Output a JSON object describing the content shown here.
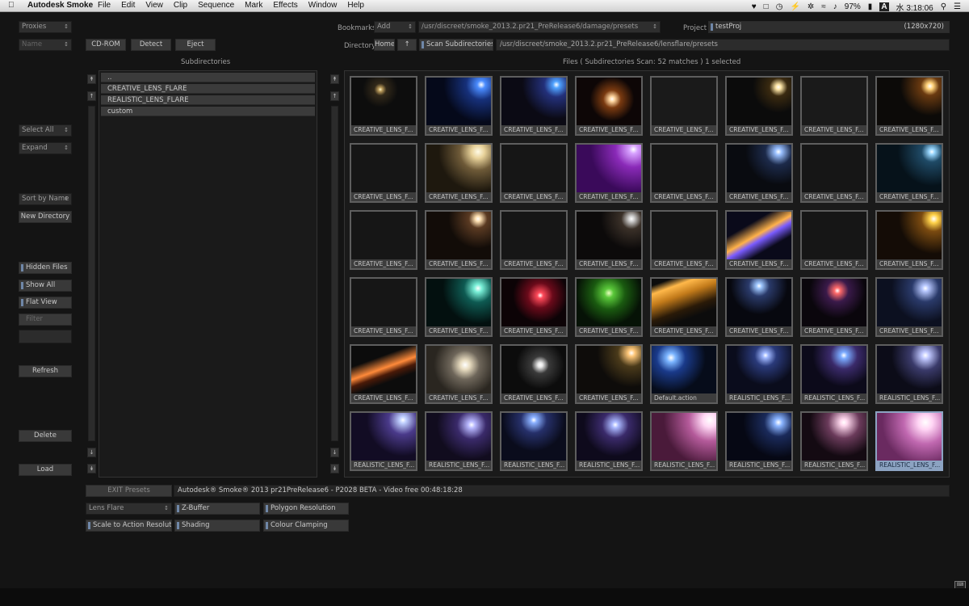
{
  "menubar": {
    "app_name": "Autodesk Smoke",
    "menus": [
      "File",
      "Edit",
      "View",
      "Clip",
      "Sequence",
      "Mark",
      "Effects",
      "Window",
      "Help"
    ],
    "battery": "97%",
    "input_mode": "A",
    "clock": "水 3:18:06"
  },
  "left": {
    "proxies": "Proxies",
    "name": "Name",
    "select_all": "Select All",
    "expand": "Expand",
    "sort_by_name": "Sort by Name",
    "new_directory": "New Directory",
    "hidden_files": "Hidden Files",
    "show_all": "Show All",
    "flat_view": "Flat View",
    "filter": "Filter",
    "filter_value": "",
    "refresh": "Refresh",
    "delete": "Delete",
    "load": "Load"
  },
  "devices": {
    "cdrom": "CD-ROM",
    "detect": "Detect",
    "eject": "Eject"
  },
  "top": {
    "bookmarks_label": "Bookmarks",
    "bookmarks_value": "Add",
    "bookmark_path": "/usr/discreet/smoke_2013.2.pr21_PreRelease6/damage/presets",
    "project_label": "Project",
    "project_value": "testProj",
    "project_res": "(1280x720)",
    "directory_label": "Directory",
    "home": "Home",
    "up_arrow": "↑",
    "scan_subdirs": "Scan Subdirectories",
    "directory_path": "/usr/discreet/smoke_2013.2.pr21_PreRelease6/lensflare/presets"
  },
  "subdirs": {
    "title": "Subdirectories",
    "items": [
      "..",
      "CREATIVE_LENS_FLARE",
      "REALISTIC_LENS_FLARE",
      "custom"
    ]
  },
  "files": {
    "title": "Files  ( Subdirectories Scan: 52 matches )  1 selected",
    "tiles": [
      {
        "label": "CREATIVE_LENS_F...",
        "bg": "radial-gradient(circle at 45% 25%, #fff6c8 0, #b99a5a 4%, rgba(120,90,40,0.3) 12%, #0d0d0d 35%)"
      },
      {
        "label": "CREATIVE_LENS_F...",
        "bg": "radial-gradient(circle at 85% 15%, #ffffff 0, #4a8cff 6%, #16307a 22%, #05091a 55%)"
      },
      {
        "label": "CREATIVE_LENS_F...",
        "bg": "radial-gradient(circle at 85% 15%, #ffffff 0, #4fa2ff 5%, #23307a 18%, #0b0a14 50%)"
      },
      {
        "label": "CREATIVE_LENS_F...",
        "bg": "radial-gradient(circle at 55% 45%, #ffffff 0, #ffd6a0 6%, #7a3a10 20%, #0d0606 50%)"
      },
      {
        "label": "CREATIVE_LENS_F...",
        "bg": "#1a1a1a"
      },
      {
        "label": "CREATIVE_LENS_F...",
        "bg": "radial-gradient(circle at 80% 20%, #ffffff 0, #ffe7a8 4%, #3a2a10 14%, #0b0b0b 40%)"
      },
      {
        "label": "CREATIVE_LENS_F...",
        "bg": "#1a1a1a"
      },
      {
        "label": "CREATIVE_LENS_F...",
        "bg": "radial-gradient(circle at 82% 18%, #ffffff 0, #ffd27a 5%, #6a3a10 14%, #0c0a08 45%)"
      },
      {
        "label": "CREATIVE_LENS_F...",
        "bg": "#161616"
      },
      {
        "label": "CREATIVE_LENS_F...",
        "bg": "radial-gradient(circle at 80% 15%, #fffbe6 0, #e8d29a 10%, #6e5a38 28%, #1e180e 60%)"
      },
      {
        "label": "CREATIVE_LENS_F...",
        "bg": "#161616"
      },
      {
        "label": "CREATIVE_LENS_F...",
        "bg": "radial-gradient(circle at 88% 10%, #ffffff 0, #d7a2ff 6%, #8a2ab8 25%, #3a0a5a 60%)"
      },
      {
        "label": "CREATIVE_LENS_F...",
        "bg": "#161616"
      },
      {
        "label": "CREATIVE_LENS_F...",
        "bg": "radial-gradient(circle at 80% 15%, #ffffff 0, #9ac0ff 5%, #1c2a4a 20%, #090b10 50%)"
      },
      {
        "label": "CREATIVE_LENS_F...",
        "bg": "#161616"
      },
      {
        "label": "CREATIVE_LENS_F...",
        "bg": "radial-gradient(circle at 85% 15%, #ffffff 0, #9ad8ff 4%, #1f4a66 15%, #06121a 50%)"
      },
      {
        "label": "CREATIVE_LENS_F...",
        "bg": "#161616"
      },
      {
        "label": "CREATIVE_LENS_F...",
        "bg": "radial-gradient(circle at 80% 15%, #ffffff 0, #ffe2b4 4%, #5a3a22 14%, #120c08 45%)"
      },
      {
        "label": "CREATIVE_LENS_F...",
        "bg": "#161616"
      },
      {
        "label": "CREATIVE_LENS_F...",
        "bg": "radial-gradient(circle at 85% 15%, #ffffff 0, #d0d0d0 4%, #3a3028 15%, #0c0a0a 45%)"
      },
      {
        "label": "CREATIVE_LENS_F...",
        "bg": "#161616"
      },
      {
        "label": "CREATIVE_LENS_F...",
        "bg": "linear-gradient(150deg, #0a0a1a 30%, #ffb24a 48%, #7a5cff 56%, #0a0a1a 72%)"
      },
      {
        "label": "CREATIVE_LENS_F...",
        "bg": "#161616"
      },
      {
        "label": "CREATIVE_LENS_F...",
        "bg": "radial-gradient(circle at 88% 15%, #ffffff 0, #ffd24a 6%, #7a4a10 18%, #140c06 50%)"
      },
      {
        "label": "CREATIVE_LENS_F...",
        "bg": "#161616"
      },
      {
        "label": "CREATIVE_LENS_F...",
        "bg": "radial-gradient(circle at 80% 20%, #ffffff 0, #7af0d8 6%, #0e5a52 22%, #03100f 55%)"
      },
      {
        "label": "CREATIVE_LENS_F...",
        "bg": "radial-gradient(circle at 60% 35%, #ffffff 0, #ff4a5a 6%, #6a0a1a 25%, #0c0306 55%)"
      },
      {
        "label": "CREATIVE_LENS_F...",
        "bg": "radial-gradient(circle at 50% 30%, #eaffc0 0, #5ac83a 10%, #1a5a10 35%, #061206 70%)"
      },
      {
        "label": "CREATIVE_LENS_F...",
        "bg": "linear-gradient(160deg, #0c0c0c 10%, #ffb84a 22%, #c27a1a 38%, #2a1a08 60%, #0c0c0c 75%)"
      },
      {
        "label": "CREATIVE_LENS_F...",
        "bg": "radial-gradient(circle at 50% 15%, #ffffff 0, #a0c8ff 5%, #2a3a6a 20%, #07080f 55%)"
      },
      {
        "label": "CREATIVE_LENS_F...",
        "bg": "radial-gradient(circle at 55% 25%, #ffffff 0, #ff6a6a 6%, #3a1a4a 22%, #0a060c 55%)"
      },
      {
        "label": "CREATIVE_LENS_F...",
        "bg": "radial-gradient(circle at 75% 20%, #ffffff 0, #b8c8ff 5%, #2a3a6a 22%, #0c1020 55%)"
      },
      {
        "label": "CREATIVE_LENS_F...",
        "bg": "linear-gradient(160deg, #0c0c0c 30%, #ff8a3a 48%, #4a1a08 58%, #0c0c0c 70%)"
      },
      {
        "label": "CREATIVE_LENS_F...",
        "bg": "radial-gradient(circle at 60% 40%, #ffffff 0, #e8dcc0 10%, #6e665a 30%, #2a2620 65%)"
      },
      {
        "label": "CREATIVE_LENS_F...",
        "bg": "radial-gradient(circle at 60% 40%, #ffffff 0, #e8e8e8 5%, #3a3a3a 18%, #0c0c0c 50%)"
      },
      {
        "label": "CREATIVE_LENS_F...",
        "bg": "radial-gradient(circle at 85% 15%, #ffffff 0, #ffc87a 5%, #4a3a1a 20%, #0e0c0a 50%)"
      },
      {
        "label": "Default.action",
        "bg": "radial-gradient(circle at 30% 25%, #ffffff 0, #7ab4ff 8%, #1a3a8a 25%, #060c1a 60%)"
      },
      {
        "label": "REALISTIC_LENS_F...",
        "bg": "radial-gradient(circle at 60% 20%, #ffffff 0, #a0b8ff 5%, #2a3a7a 20%, #0a0c1c 55%)"
      },
      {
        "label": "REALISTIC_LENS_F...",
        "bg": "radial-gradient(circle at 65% 20%, #ffffff 0, #7aaaff 6%, #3a2a6a 24%, #0c0a1a 55%)"
      },
      {
        "label": "REALISTIC_LENS_F...",
        "bg": "radial-gradient(circle at 75% 20%, #ffffff 0, #c0c8ff 6%, #3a3a6a 24%, #0c0c18 55%)"
      },
      {
        "label": "REALISTIC_LENS_F...",
        "bg": "radial-gradient(circle at 80% 15%, #ffffff 0, #c0d0ff 5%, #4a3a8a 22%, #120c24 55%)"
      },
      {
        "label": "REALISTIC_LENS_F...",
        "bg": "radial-gradient(circle at 70% 25%, #fff 0, #b8b8ff 6%, #3a2a6a 25%, #110c1e 60%)"
      },
      {
        "label": "REALISTIC_LENS_F...",
        "bg": "radial-gradient(circle at 50% 15%, #fff 0, #8ab0ff 6%, #26306a 25%, #0a0c1c 60%)"
      },
      {
        "label": "REALISTIC_LENS_F...",
        "bg": "radial-gradient(circle at 60% 25%, #fff 0, #aab8ff 6%, #3a2a6a 25%, #0e0a1c 60%)"
      },
      {
        "label": "REALISTIC_LENS_F...",
        "bg": "radial-gradient(circle at 90% 15%, #ffffff 0, #ffd8f4 10%, #b45a9a 30%, #4a1a3a 65%)"
      },
      {
        "label": "REALISTIC_LENS_F...",
        "bg": "radial-gradient(circle at 80% 20%, #ffffff 0, #8ab4ff 6%, #1a2a5a 22%, #060814 55%)"
      },
      {
        "label": "REALISTIC_LENS_F...",
        "bg": "radial-gradient(circle at 65% 20%, #ffffff 0, #ffd8ee 6%, #6a3a5a 28%, #140a12 60%)"
      },
      {
        "label": "REALISTIC_LENS_F...",
        "bg": "radial-gradient(circle at 75% 20%, #ffffff 0, #ffd4f4 12%, #c068b0 35%, #6a2a60 70%)"
      }
    ]
  },
  "status": {
    "exit_presets": "EXIT Presets",
    "message": "Autodesk® Smoke® 2013 pr21PreRelease6 - P2028 BETA - Video free 00:48:18:28"
  },
  "options": {
    "effect": "Lens Flare",
    "z_buffer": "Z-Buffer",
    "polygon_resolution": "Polygon Resolution",
    "scale_to_action": "Scale to Action Resolution",
    "shading": "Shading",
    "colour_clamping": "Colour Clamping"
  },
  "colors": {
    "accent": "#6f87a8",
    "selected": "#8ca3c2",
    "background": "#141414"
  }
}
